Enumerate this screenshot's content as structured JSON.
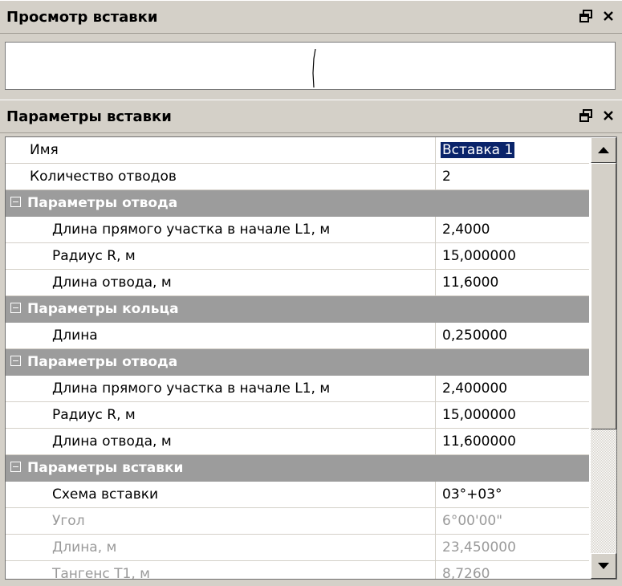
{
  "preview_panel": {
    "title": "Просмотр вставки"
  },
  "params_panel": {
    "title": "Параметры вставки"
  },
  "rows": [
    {
      "kind": "top",
      "name": "Имя",
      "value": "Вставка 1",
      "selected": true
    },
    {
      "kind": "top",
      "name": "Количество отводов",
      "value": "2"
    },
    {
      "kind": "group",
      "name": "Параметры отвода"
    },
    {
      "kind": "sub",
      "name": "Длина прямого участка в начале L1, м",
      "value": "2,4000"
    },
    {
      "kind": "sub",
      "name": "Радиус R, м",
      "value": "15,000000"
    },
    {
      "kind": "sub",
      "name": "Длина отвода, м",
      "value": "11,6000"
    },
    {
      "kind": "group",
      "name": "Параметры кольца"
    },
    {
      "kind": "sub",
      "name": "Длина",
      "value": "0,250000"
    },
    {
      "kind": "group",
      "name": "Параметры отвода"
    },
    {
      "kind": "sub",
      "name": "Длина прямого участка в начале L1, м",
      "value": "2,400000"
    },
    {
      "kind": "sub",
      "name": "Радиус R, м",
      "value": "15,000000"
    },
    {
      "kind": "sub",
      "name": "Длина отвода, м",
      "value": "11,600000"
    },
    {
      "kind": "group",
      "name": "Параметры вставки"
    },
    {
      "kind": "sub",
      "name": "Схема вставки",
      "value": "03°+03°"
    },
    {
      "kind": "sub",
      "name": "Угол",
      "value": "6°00'00\"",
      "readonly": true,
      "centered": true
    },
    {
      "kind": "sub",
      "name": "Длина, м",
      "value": "23,450000",
      "readonly": true
    },
    {
      "kind": "sub",
      "name": "Тангенс Т1, м",
      "value": "8,7260",
      "readonly": true
    }
  ]
}
